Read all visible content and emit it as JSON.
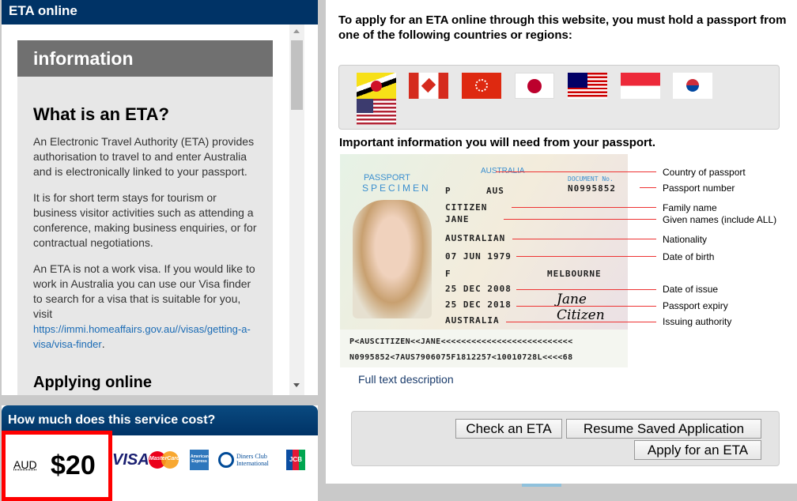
{
  "left_panel": {
    "title": "ETA online",
    "section_title": "information",
    "heading": "What is an ETA?",
    "paragraphs": [
      "An Electronic Travel Authority (ETA) provides authorisation to travel to and enter Australia and is electronically linked to your passport.",
      "It is for short term stays for tourism or business visitor activities such as attending a conference, making business enquiries, or for contractual negotiations.",
      "An ETA is not a work visa. If you would like to work in Australia you can use our Visa finder to search for a visa that is suitable for you, visit"
    ],
    "link": "https://immi.homeaffairs.gov.au//visas/getting-a-visa/visa-finder",
    "link_suffix": ".",
    "next_heading": "Applying online"
  },
  "cost": {
    "title": "How much does this service cost?",
    "currency": "AUD",
    "amount": "$20",
    "cards": [
      "VISA",
      "MasterCard",
      "American Express",
      "Diners Club International",
      "JCB"
    ]
  },
  "right_panel": {
    "intro": "To apply for an ETA online through this website, you must hold a passport from one of the following countries or regions:",
    "flags": [
      "Brunei",
      "Canada",
      "Hong Kong",
      "Japan",
      "Malaysia",
      "Singapore",
      "South Korea",
      "United States"
    ],
    "important_title": "Important information you will need from your passport.",
    "passport": {
      "header": "PASSPORT",
      "specimen": "SPECIMEN",
      "country": "AUSTRALIA",
      "type": "P",
      "code": "AUS",
      "doc_label": "DOCUMENT No.",
      "doc_no": "N0995852",
      "surname": "CITIZEN",
      "given": "JANE",
      "nationality": "AUSTRALIAN",
      "dob": "07 JUN 1979",
      "sex": "F",
      "pob": "MELBOURNE",
      "issue": "25 DEC 2008",
      "expiry": "25 DEC 2018",
      "authority": "AUSTRALIA",
      "signature": "Jane Citizen",
      "mrz1": "P<AUSCITIZEN<<JANE<<<<<<<<<<<<<<<<<<<<<<<<<<",
      "mrz2": "N0995852<7AUS7906075F1812257<10010728L<<<<68"
    },
    "labels": [
      "Country of passport",
      "Passport number",
      "Family name",
      "Given names (include ALL)",
      "Nationality",
      "Date of birth",
      "Date of issue",
      "Passport expiry",
      "Issuing authority"
    ],
    "full_text": "Full text description",
    "buttons": {
      "check": "Check an ETA",
      "resume": "Resume Saved Application",
      "apply": "Apply for an ETA"
    }
  }
}
